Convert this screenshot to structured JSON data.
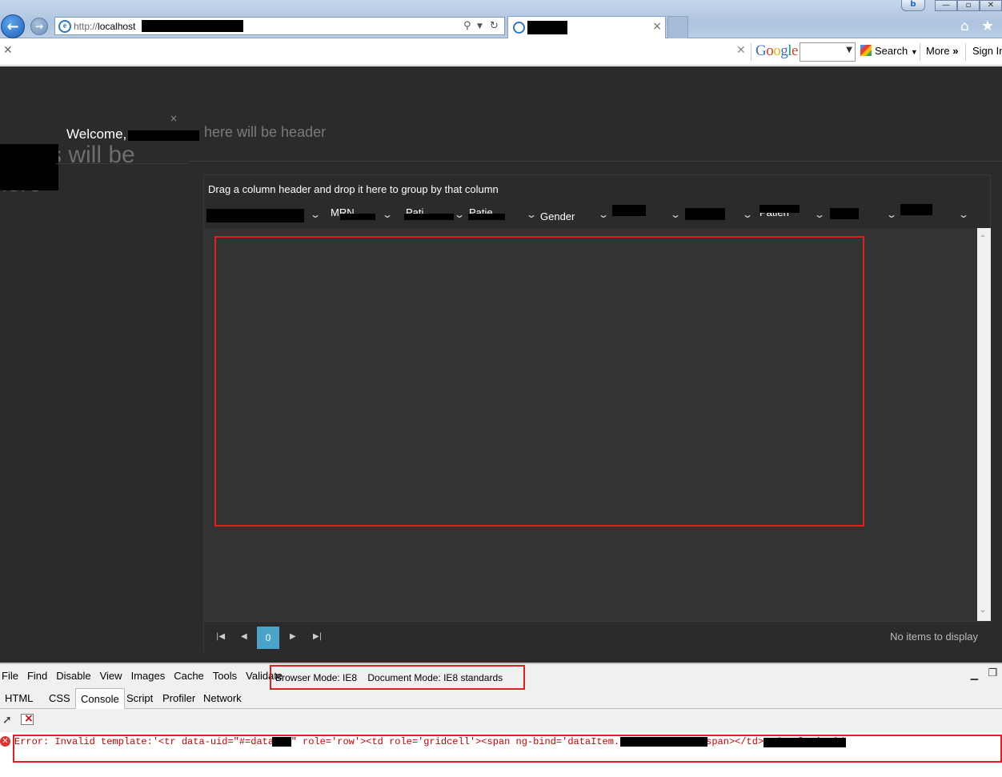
{
  "browser": {
    "address_scheme": "http://",
    "address_host": "localhost",
    "tab_close": "×",
    "win_controls": [
      "—",
      "▫",
      "✕"
    ],
    "home_icon": "home-icon",
    "favorites_icon": "star-icon"
  },
  "google_toolbar": {
    "logo": "Google",
    "search_label": "Search",
    "more_label": "More",
    "signin_label": "Sign In"
  },
  "page": {
    "welcome": "Welcome,",
    "header_placeholder": "here will be header",
    "side_text_1": "s will be",
    "side_text_2": "here",
    "close_glyph": "×"
  },
  "grid": {
    "group_hint": "Drag a column header and drop it here to group by that column",
    "columns": [
      "",
      "MRN",
      "Pati",
      "Patie",
      "Gender",
      "",
      "",
      "Patien",
      "",
      ""
    ],
    "current_page": "0",
    "pager_info": "No items to display"
  },
  "devtools": {
    "menu": [
      "File",
      "Find",
      "Disable",
      "View",
      "Images",
      "Cache",
      "Tools",
      "Validate"
    ],
    "browser_mode": "Browser Mode:  IE8",
    "document_mode": "Document Mode:  IE8 standards",
    "tabs": [
      "HTML",
      "CSS",
      "Console",
      "Script",
      "Profiler",
      "Network"
    ],
    "active_tab": "Console",
    "error_text": "Error: Invalid template:'<tr data-uid=\"#=data.    #\" role='row'><td  role='gridcell'><span ng-bind='dataItem.              >#: data.p              #</span></td><td  role='grid"
  }
}
